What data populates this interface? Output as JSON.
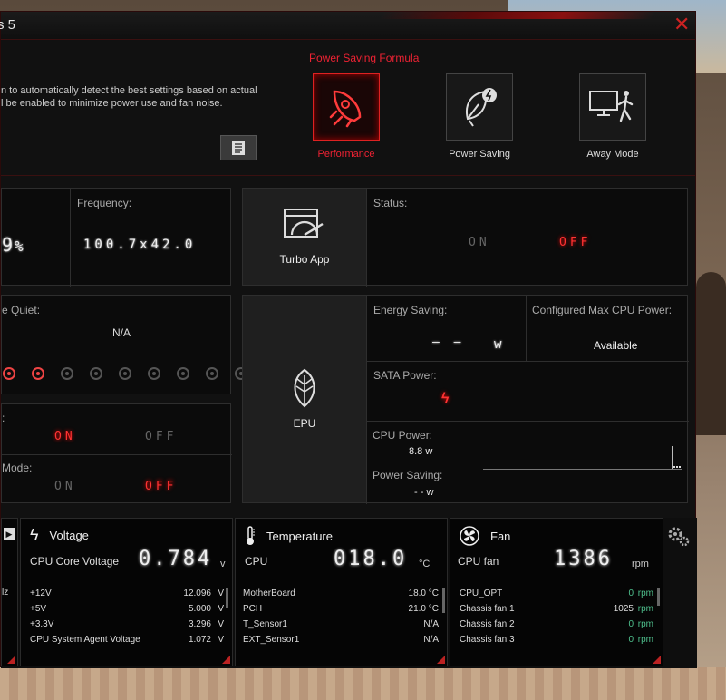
{
  "window": {
    "title": "s 5"
  },
  "top": {
    "desc_line1": "n to automatically detect the best settings based on actual",
    "desc_line2": "l be enabled to minimize power use and fan noise.",
    "formula_title": "Power Saving Formula",
    "modes": [
      {
        "label": "Performance",
        "active": true
      },
      {
        "label": "Power Saving",
        "active": false
      },
      {
        "label": "Away Mode",
        "active": false
      }
    ]
  },
  "tpu": {
    "percent_digit": "9",
    "percent_sign": "%",
    "frequency_label": "Frequency:",
    "frequency_value": "100.7x42.0"
  },
  "turbo": {
    "name": "Turbo App",
    "status_label": "Status:",
    "on": "ON",
    "off": "OFF"
  },
  "fan_quiet": {
    "label": "e Quiet:",
    "value": "N/A"
  },
  "toggle1": {
    "label": ":",
    "on": "ON",
    "off": "OFF"
  },
  "toggle2": {
    "label": "Mode:",
    "on": "ON",
    "off": "OFF"
  },
  "epu": {
    "name": "EPU",
    "energy_label": "Energy Saving:",
    "energy_value": "— —",
    "energy_unit": "w",
    "max_cpu_label": "Configured Max CPU Power:",
    "max_cpu_value": "Available",
    "sata_label": "SATA Power:",
    "cpu_power_label": "CPU Power:",
    "cpu_power_value": "8.8 w",
    "power_saving_label": "Power Saving:",
    "power_saving_value": "- - w"
  },
  "left_module": {
    "frag": "lz"
  },
  "voltage": {
    "title": "Voltage",
    "main_label": "CPU Core Voltage",
    "main_value": "0.784",
    "main_unit": "v",
    "rows": [
      {
        "name": "+12V",
        "value": "12.096",
        "unit": "V"
      },
      {
        "name": "+5V",
        "value": "5.000",
        "unit": "V"
      },
      {
        "name": "+3.3V",
        "value": "3.296",
        "unit": "V"
      },
      {
        "name": "CPU System Agent Voltage",
        "value": "1.072",
        "unit": "V"
      }
    ]
  },
  "temperature": {
    "title": "Temperature",
    "main_label": "CPU",
    "main_value": "018.0",
    "main_unit": "°C",
    "rows": [
      {
        "name": "MotherBoard",
        "value": "18.0 °C"
      },
      {
        "name": "PCH",
        "value": "21.0 °C"
      },
      {
        "name": "T_Sensor1",
        "value": "N/A"
      },
      {
        "name": "EXT_Sensor1",
        "value": "N/A"
      }
    ]
  },
  "fan": {
    "title": "Fan",
    "main_label": "CPU fan",
    "main_value": "1386",
    "main_unit": "rpm",
    "rows": [
      {
        "name": "CPU_OPT",
        "value": "0",
        "unit": "rpm"
      },
      {
        "name": "Chassis fan 1",
        "value": "1025",
        "unit": "rpm"
      },
      {
        "name": "Chassis fan 2",
        "value": "0",
        "unit": "rpm"
      },
      {
        "name": "Chassis fan 3",
        "value": "0",
        "unit": "rpm"
      }
    ]
  },
  "colors": {
    "accent_red": "#e22222",
    "rpm_green": "#4fc08d"
  }
}
